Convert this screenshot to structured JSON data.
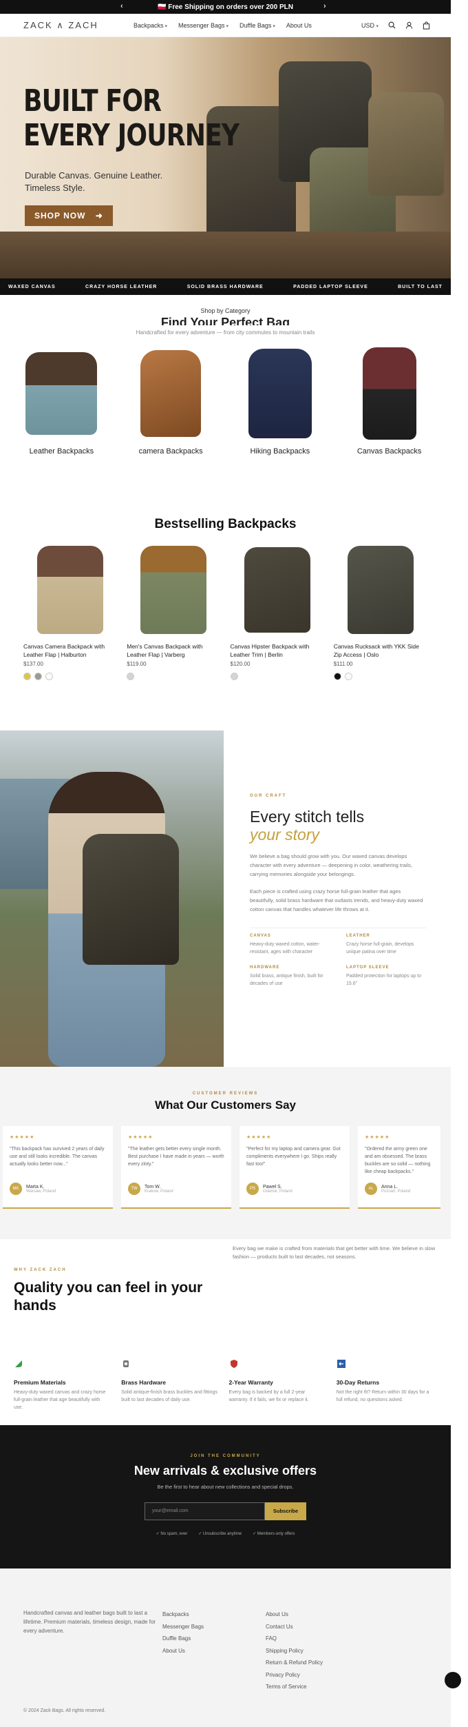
{
  "announcement": {
    "text": "🇵🇱 Free Shipping on orders over 200 PLN",
    "prev": "‹",
    "next": "›"
  },
  "header": {
    "logo": "ZACK ∧ ZACH",
    "nav": [
      "Backpacks",
      "Messenger Bags",
      "Duffle Bags",
      "About Us"
    ],
    "currency": "USD"
  },
  "hero": {
    "title_line1": "BUILT FOR",
    "title_line2": "EVERY JOURNEY",
    "subtitle_line1": "Durable Canvas. Genuine Leather.",
    "subtitle_line2": "Timeless Style.",
    "cta": "SHOP NOW"
  },
  "marquee": [
    "WAXED CANVAS",
    "CRAZY HORSE LEATHER",
    "SOLID BRASS HARDWARE",
    "PADDED LAPTOP SLEEVE",
    "BUILT TO LAST"
  ],
  "categories": {
    "eyebrow": "Shop by Category",
    "title": "Find Your Perfect Bag",
    "subtitle": "Handcrafted for every adventure — from city commutes to mountain trails",
    "items": [
      {
        "label": "Leather Backpacks"
      },
      {
        "label": "camera Backpacks"
      },
      {
        "label": "Hiking Backpacks"
      },
      {
        "label": "Canvas Backpacks"
      }
    ]
  },
  "bestsellers": {
    "title": "Bestselling Backpacks",
    "products": [
      {
        "name": "Canvas Camera Backpack with Leather Flap | Halburton",
        "price": "$137.00"
      },
      {
        "name": "Men's Canvas Backpack with Leather Flap | Varberg",
        "price": "$119.00"
      },
      {
        "name": "Canvas Hipster Backpack with Leather Trim | Berlin",
        "price": "$120.00"
      },
      {
        "name": "Canvas Rucksack with YKK Side Zip Access | Oslo",
        "price": "$111.00"
      }
    ]
  },
  "story": {
    "eyebrow": "OUR CRAFT",
    "title": "Every stitch tells",
    "title_accent": "your story",
    "p1": "We believe a bag should grow with you. Our waxed canvas develops character with every adventure — deepening in color, weathering trails, carrying memories alongside your belongings.",
    "p2": "Each piece is crafted using crazy horse full-grain leather that ages beautifully, solid brass hardware that outlasts trends, and heavy-duty waxed cotton canvas that handles whatever life throws at it.",
    "features": [
      {
        "k": "CANVAS",
        "v": "Heavy-duty waxed cotton, water-resistant, ages with character"
      },
      {
        "k": "LEATHER",
        "v": "Crazy horse full-grain, develops unique patina over time"
      },
      {
        "k": "HARDWARE",
        "v": "Solid brass, antique finish, built for decades of use"
      },
      {
        "k": "LAPTOP SLEEVE",
        "v": "Padded protection for laptops up to 15.6\""
      }
    ]
  },
  "reviews": {
    "eyebrow": "CUSTOMER REVIEWS",
    "title": "What Our Customers Say",
    "items": [
      {
        "stars": "★★★★★",
        "text": "\"This backpack has survived 2 years of daily use and still looks incredible. The canvas actually looks better now...\"",
        "name": "Marta K.",
        "loc": "Warsaw, Poland",
        "initials": "MK"
      },
      {
        "stars": "★★★★★",
        "text": "\"The leather gets better every single month. Best purchase I have made in years — worth every zloty.\"",
        "name": "Tom W.",
        "loc": "Krakow, Poland",
        "initials": "TW"
      },
      {
        "stars": "★★★★★",
        "text": "\"Perfect for my laptop and camera gear. Got compliments everywhere I go. Ships really fast too!\"",
        "name": "Paweł S.",
        "loc": "Gdańsk, Poland",
        "initials": "PS"
      },
      {
        "stars": "★★★★★",
        "text": "\"Ordered the army green one and am obsessed. The brass buckles are so solid — nothing like cheap backpacks.\"",
        "name": "Anna L.",
        "loc": "Poznań, Poland",
        "initials": "AL"
      }
    ]
  },
  "quality": {
    "eyebrow": "WHY ZACK ZACH",
    "title": "Quality you can feel in your hands",
    "side": "Every bag we make is crafted from materials that get better with time. We believe in slow fashion — products built to last decades, not seasons.",
    "features": [
      {
        "t": "Premium Materials",
        "d": "Heavy-duty waxed canvas and crazy horse full-grain leather that age beautifully with use."
      },
      {
        "t": "Brass Hardware",
        "d": "Solid antique-finish brass buckles and fittings built to last decades of daily use."
      },
      {
        "t": "2-Year Warranty",
        "d": "Every bag is backed by a full 2-year warranty. If it fails, we fix or replace it."
      },
      {
        "t": "30-Day Returns",
        "d": "Not the right fit? Return within 30 days for a full refund, no questions asked."
      }
    ]
  },
  "newsletter": {
    "eyebrow": "JOIN THE COMMUNITY",
    "title": "New arrivals & exclusive offers",
    "subtitle": "Be the first to hear about new collections and special drops.",
    "placeholder": "your@email.com",
    "button": "Subscribe",
    "checks": [
      "✓ No spam, ever",
      "✓ Unsubscribe anytime",
      "✓ Members-only offers"
    ]
  },
  "footer": {
    "about": "Handcrafted canvas and leather bags built to last a lifetime. Premium materials, timeless design, made for every adventure.",
    "shop": [
      "Backpacks",
      "Messenger Bags",
      "Duffle Bags",
      "About Us"
    ],
    "info": [
      "About Us",
      "Contact Us",
      "FAQ",
      "Shipping Policy",
      "Return & Refund Policy",
      "Privacy Policy",
      "Terms of Service"
    ],
    "copyright": "© 2024 Zack Bags. All rights reserved."
  },
  "colors": {
    "accent_gold": "#c9a84a",
    "cta_brown": "#8a5a2b",
    "dark": "#111111"
  },
  "icons": [
    "search-icon",
    "user-icon",
    "cart-icon",
    "arrow-right-icon",
    "chat-icon"
  ]
}
